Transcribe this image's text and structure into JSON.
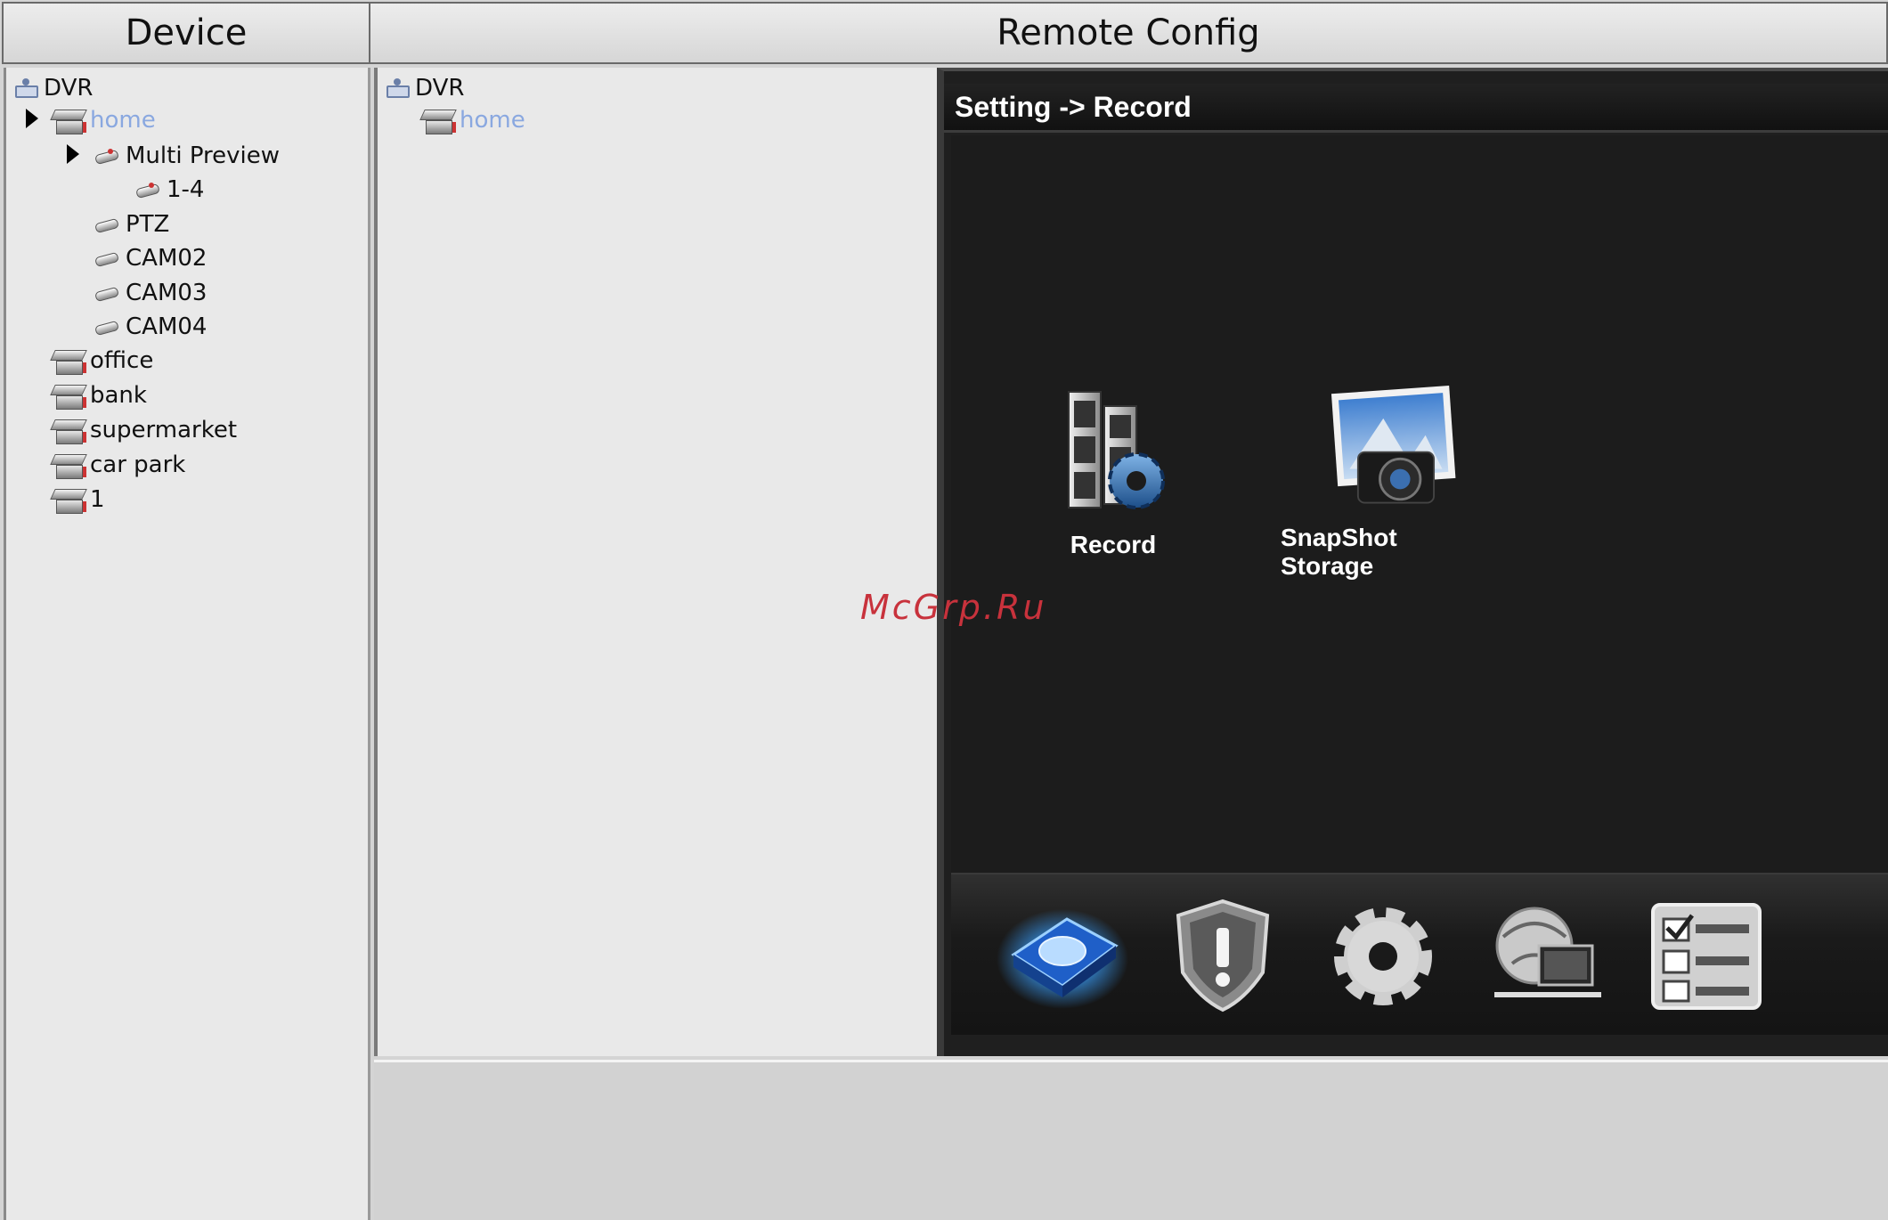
{
  "headers": {
    "device": "Device",
    "remote_config": "Remote Config"
  },
  "device_tree": {
    "root": "DVR",
    "home": "home",
    "multi_preview": "Multi Preview",
    "preview_1_4": "1-4",
    "ptz": "PTZ",
    "cam02": "CAM02",
    "cam03": "CAM03",
    "cam04": "CAM04",
    "office": "office",
    "bank": "bank",
    "supermarket": "supermarket",
    "car_park": "car park",
    "device_1": "1"
  },
  "remote_tree": {
    "root": "DVR",
    "home": "home"
  },
  "config": {
    "breadcrumb": "Setting -> Record",
    "tiles": [
      {
        "label": "Record",
        "icon": "film-gear-icon"
      },
      {
        "label": "SnapShot Storage",
        "icon": "camera-photo-icon"
      }
    ],
    "bottom_icons": [
      "storage-disk-icon",
      "alarm-shield-icon",
      "system-gear-icon",
      "network-icon",
      "info-checklist-icon"
    ]
  },
  "watermark": "McGrp.Ru"
}
